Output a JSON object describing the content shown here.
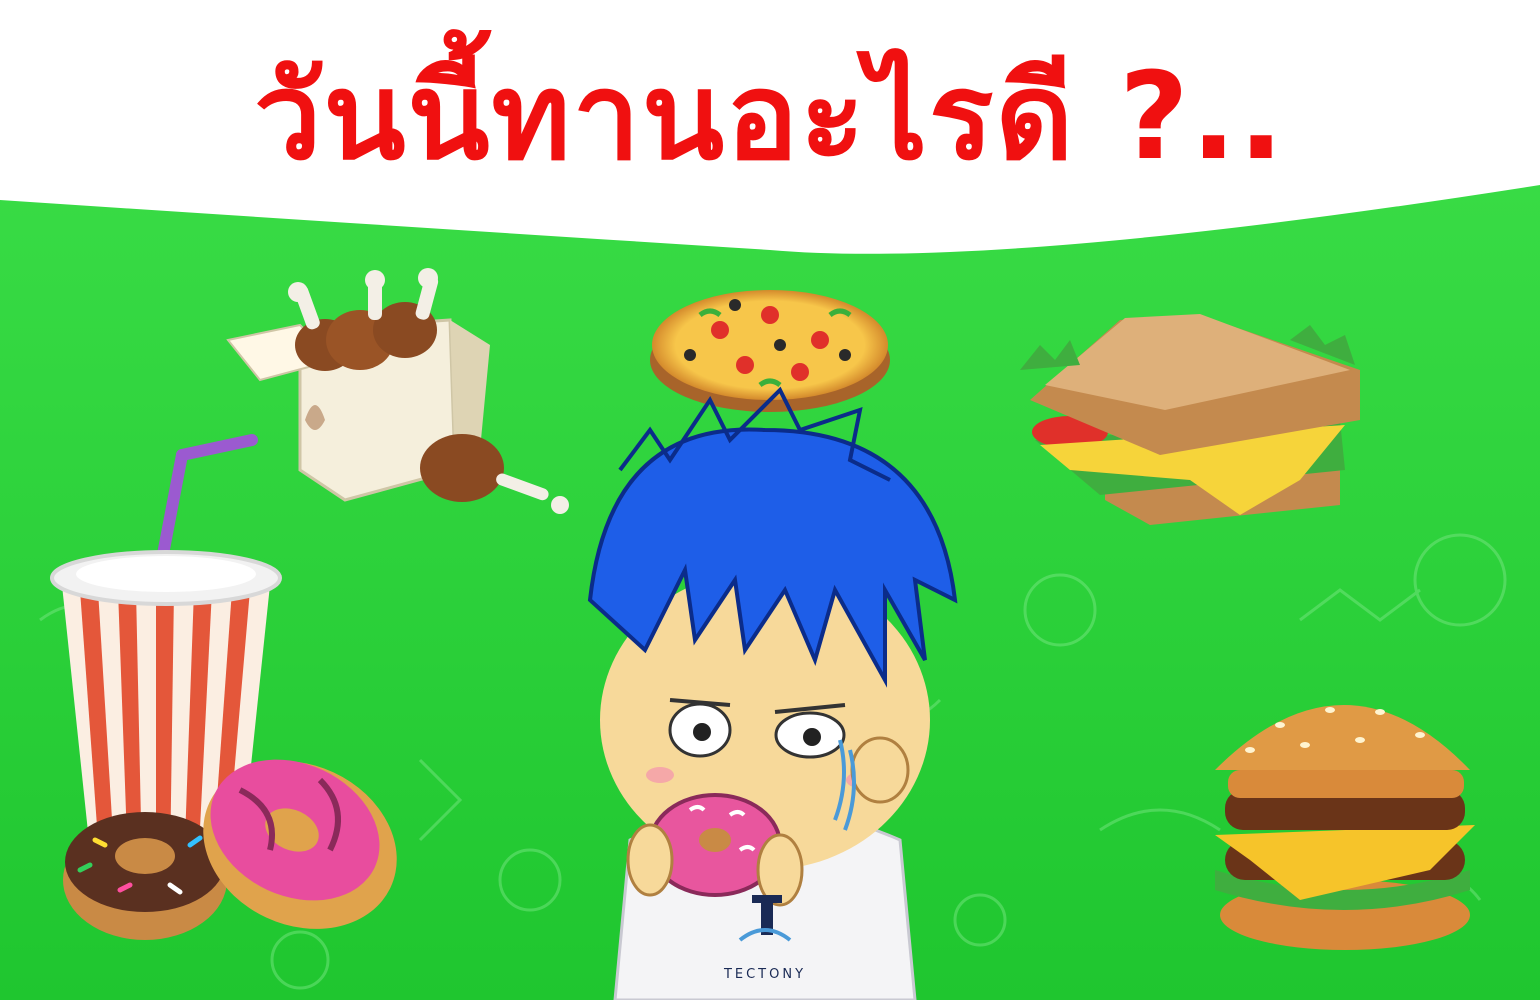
{
  "headline": "วันนี้ทานอะไรดี ?..",
  "shirt_logo_text": "TECTONY",
  "colors": {
    "background_green": "#2bd43a",
    "header_white": "#ffffff",
    "title_red": "#f01010",
    "hair_blue": "#1e5ee8"
  },
  "illustrations": [
    "fried-chicken-box-icon",
    "pizza-icon",
    "sandwich-icon",
    "soda-cup-icon",
    "donuts-icon",
    "burger-icon",
    "boy-eating-donut-character"
  ]
}
